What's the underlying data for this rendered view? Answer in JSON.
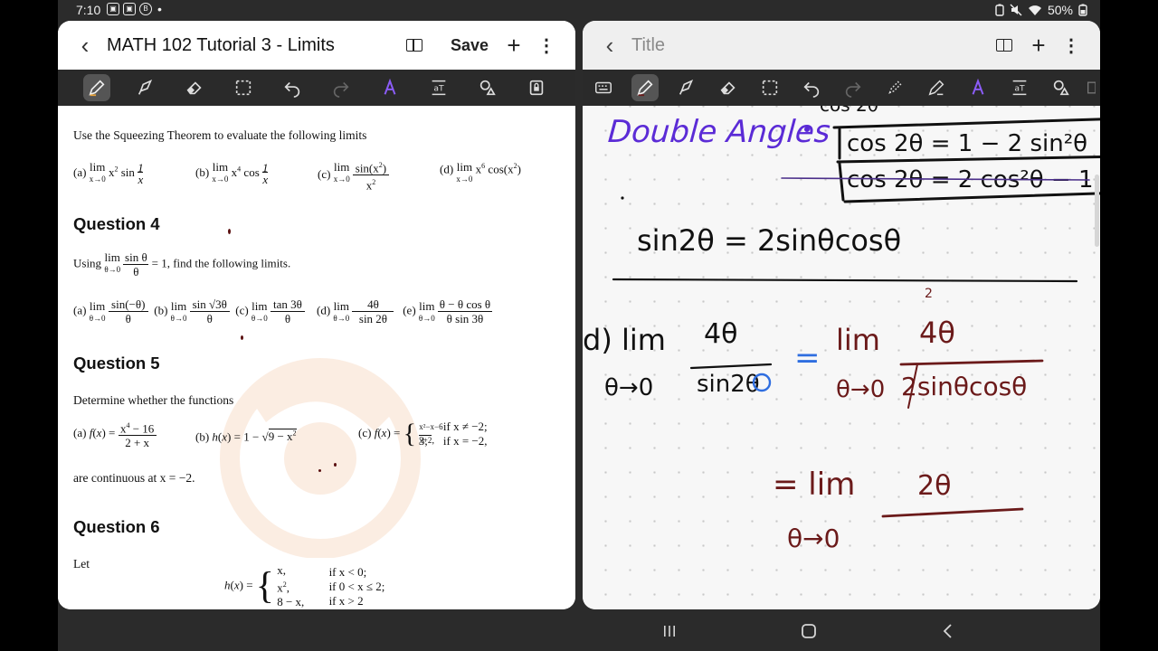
{
  "status": {
    "time": "7:10",
    "battery": "50%"
  },
  "left": {
    "title": "MATH 102 Tutorial 3 - Limits",
    "save_label": "Save",
    "content": {
      "intro": "Use the Squeezing Theorem to evaluate the following limits",
      "q4": "Question 4",
      "q4_using": "Using",
      "q4_find": "= 1, find the following limits.",
      "q5": "Question 5",
      "q5_text": "Determine whether the functions",
      "q5_cont": "are continuous at x = −2.",
      "q6": "Question 6",
      "q6_let": "Let"
    }
  },
  "right": {
    "title": "Title"
  },
  "colors": {
    "handle": "#2f7ae5",
    "highlighter_purple": "#5b2bd6"
  }
}
